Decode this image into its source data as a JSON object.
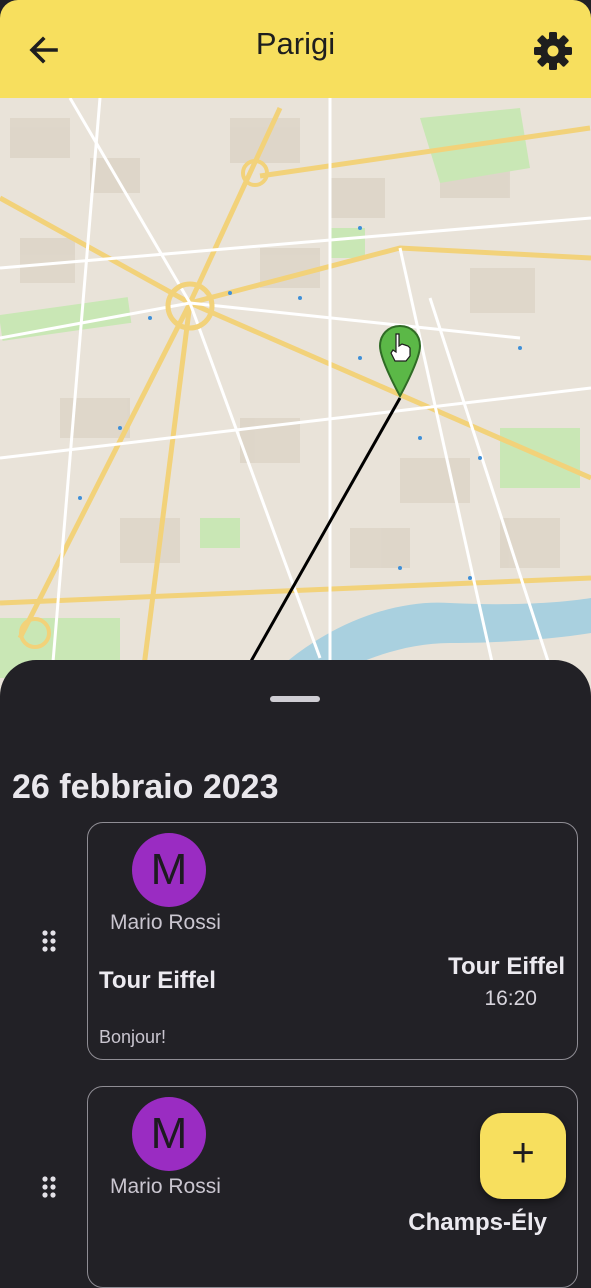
{
  "appbar": {
    "title": "Parigi",
    "back_icon": "arrow-left-icon",
    "settings_icon": "gear-icon",
    "color": "#f7df5e"
  },
  "map": {
    "marker_icon": "map-pin-hand-icon",
    "marker_color": "#5bb847"
  },
  "sheet": {
    "date_heading": "26 febbraio 2023",
    "background": "#222126"
  },
  "entries": [
    {
      "avatar_initial": "M",
      "author": "Mario Rossi",
      "place": "Tour Eiffel",
      "destination": "Tour Eiffel",
      "time": "16:20",
      "note": "Bonjour!"
    },
    {
      "avatar_initial": "M",
      "author": "Mario Rossi",
      "destination": "Champs-Ély"
    }
  ],
  "fab": {
    "label": "+",
    "icon": "add-icon"
  }
}
